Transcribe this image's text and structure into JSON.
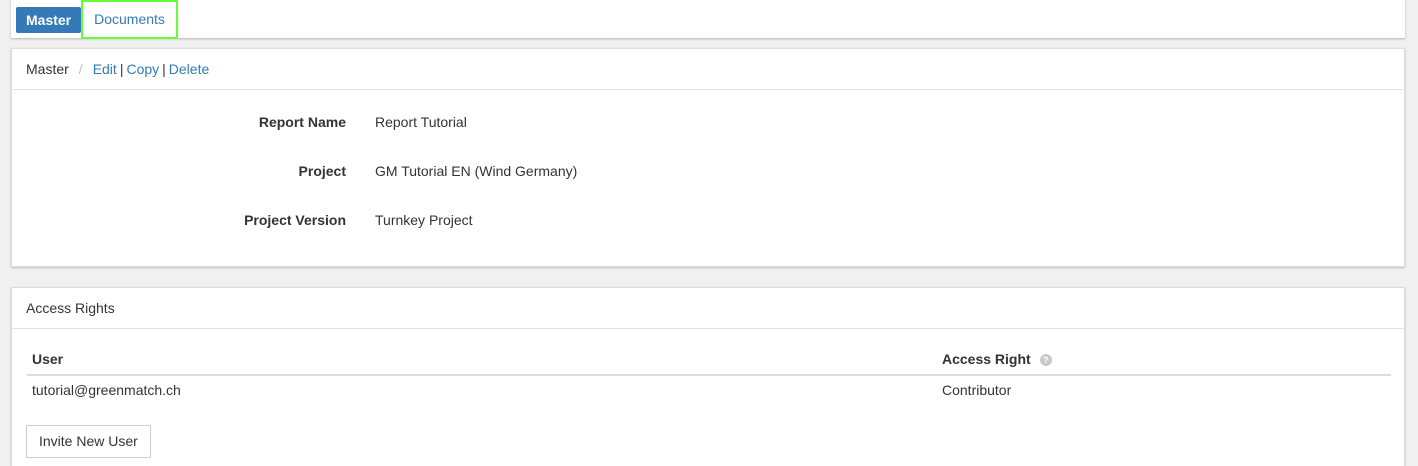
{
  "tabs": {
    "master": "Master",
    "documents": "Documents"
  },
  "master_panel": {
    "breadcrumb": "Master",
    "separator": "/",
    "actions": {
      "edit": "Edit",
      "copy": "Copy",
      "delete": "Delete",
      "pipe": "|"
    },
    "fields": [
      {
        "label": "Report Name",
        "value": "Report Tutorial"
      },
      {
        "label": "Project",
        "value": "GM Tutorial EN (Wind Germany)"
      },
      {
        "label": "Project Version",
        "value": "Turnkey Project"
      }
    ]
  },
  "access_panel": {
    "title": "Access Rights",
    "columns": {
      "user": "User",
      "access_right": "Access Right",
      "help_icon": "?"
    },
    "rows": [
      {
        "user": "tutorial@greenmatch.ch",
        "access_right": "Contributor"
      }
    ],
    "invite_label": "Invite New User"
  },
  "colors": {
    "primary": "#337ab7",
    "highlight": "#66ff33"
  }
}
